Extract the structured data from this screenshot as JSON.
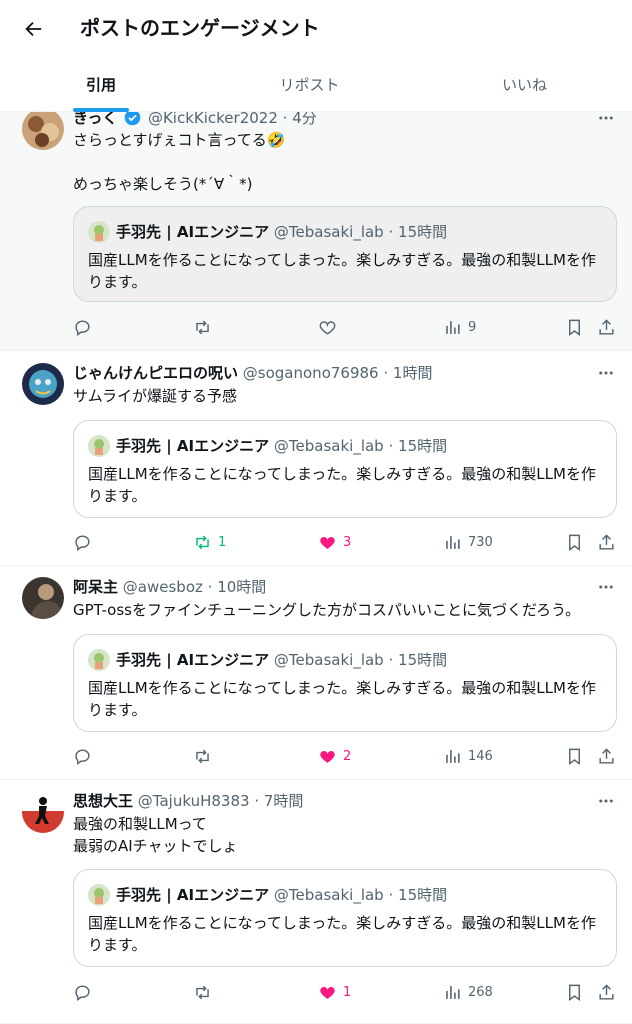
{
  "header": {
    "title": "ポストのエンゲージメント",
    "tabs": [
      "引用",
      "リポスト",
      "いいね"
    ]
  },
  "quoted": {
    "name": "手羽先 | AIエンジニア",
    "handle": "@Tebasaki_lab",
    "time": "· 15時間",
    "text": "国産LLMを作ることになってしまった。楽しみすぎる。最強の和製LLMを作ります。"
  },
  "posts": [
    {
      "name": "きっく",
      "handle": "@KickKicker2022",
      "time": "· 4分",
      "verified": true,
      "text": "さらっとすげぇコト言ってる🤣\n\nめっちゃ楽しそう(*´∀｀*)",
      "reply": "",
      "repost": "",
      "like": "",
      "views": "9"
    },
    {
      "name": "じゃんけんピエロの呪い",
      "handle": "@soganono76986",
      "time": "· 1時間",
      "text": "サムライが爆誕する予感",
      "reply": "",
      "repost": "1",
      "like": "3",
      "views": "730"
    },
    {
      "name": "阿呆主",
      "handle": "@awesboz",
      "time": "· 10時間",
      "text": "GPT-ossをファインチューニングした方がコスパいいことに気づくだろう。",
      "reply": "",
      "repost": "",
      "like": "2",
      "views": "146"
    },
    {
      "name": "思想大王",
      "handle": "@TajukuH8383",
      "time": "· 7時間",
      "text": "最強の和製LLMって\n最弱のAIチャットでしょ",
      "reply": "",
      "repost": "",
      "like": "1",
      "views": "268"
    }
  ],
  "colors": {
    "accent": "#1d9bf0",
    "repost_active": "#00ba7c",
    "like_active": "#f91880",
    "muted": "#536471"
  }
}
